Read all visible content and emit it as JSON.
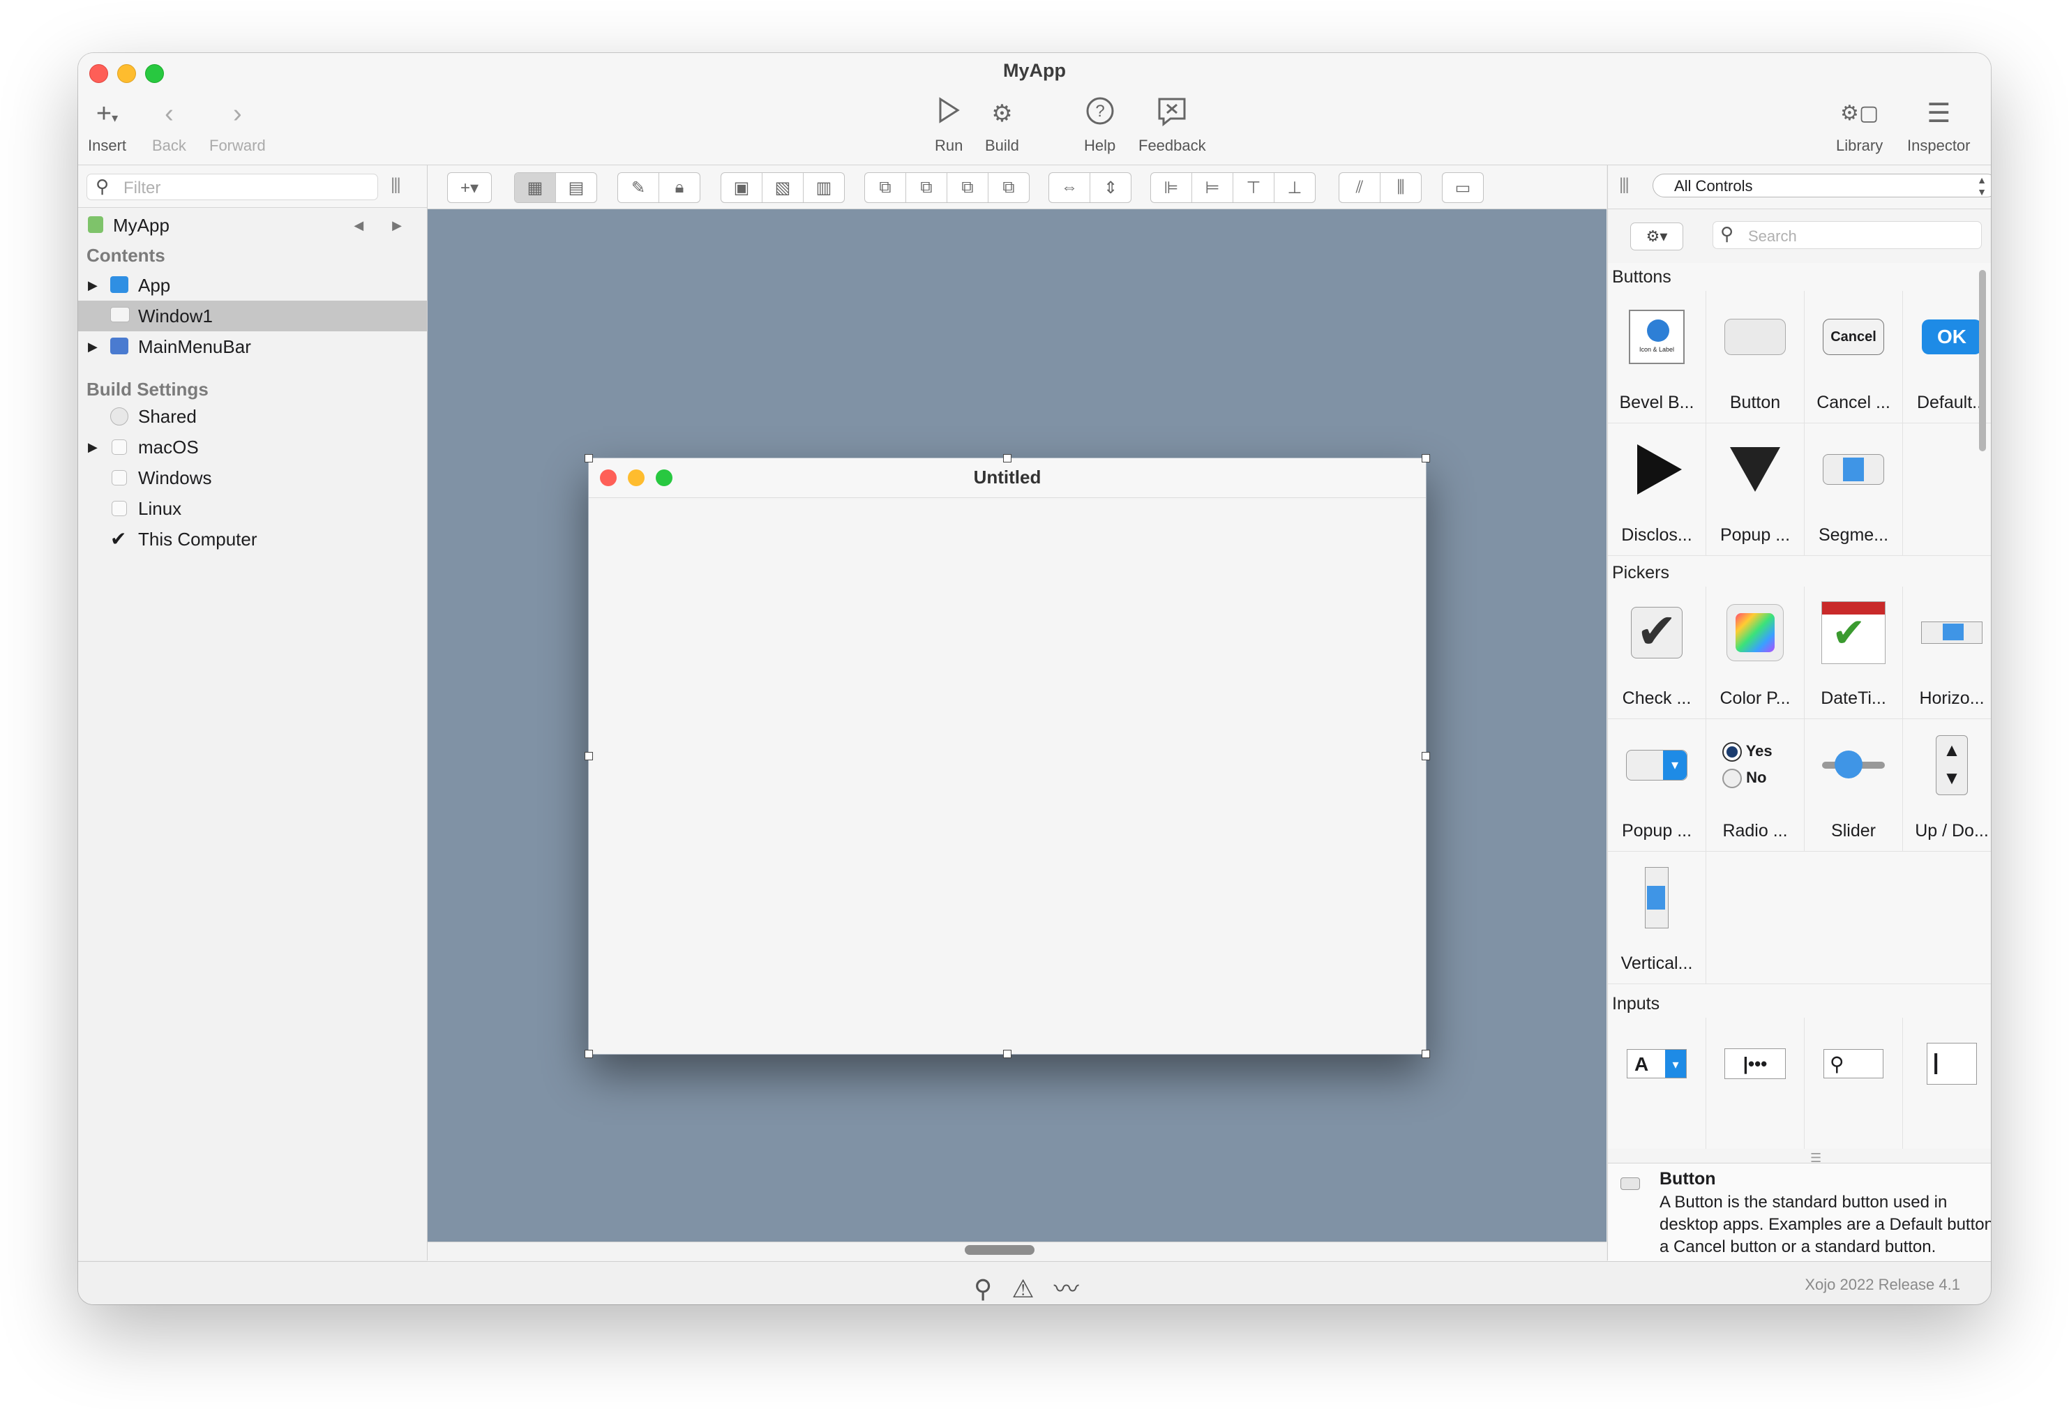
{
  "window": {
    "title": "MyApp"
  },
  "toolbar": {
    "insert": "Insert",
    "back": "Back",
    "forward": "Forward",
    "run": "Run",
    "build": "Build",
    "help": "Help",
    "feedback": "Feedback",
    "library": "Library",
    "inspector": "Inspector"
  },
  "navigator": {
    "filter_placeholder": "Filter",
    "project": "MyApp",
    "contents_header": "Contents",
    "items": [
      {
        "label": "App"
      },
      {
        "label": "Window1",
        "selected": true
      },
      {
        "label": "MainMenuBar"
      }
    ],
    "build_header": "Build Settings",
    "build_items": [
      {
        "label": "Shared"
      },
      {
        "label": "macOS",
        "checked": false
      },
      {
        "label": "Windows",
        "checked": false
      },
      {
        "label": "Linux",
        "checked": false
      },
      {
        "label": "This Computer",
        "checked": true
      }
    ]
  },
  "design_window": {
    "title": "Untitled"
  },
  "library": {
    "filter": "All Controls",
    "search_placeholder": "Search",
    "sections": {
      "buttons": "Buttons",
      "pickers": "Pickers",
      "inputs": "Inputs"
    },
    "buttons": [
      "Bevel B...",
      "Button",
      "Cancel ...",
      "Default...",
      "Disclos...",
      "Popup ...",
      "Segme..."
    ],
    "pickers": [
      "Check ...",
      "Color P...",
      "DateTi...",
      "Horizo...",
      "Popup ...",
      "Radio ...",
      "Slider",
      "Up / Do...",
      "Vertical..."
    ],
    "icon_text": {
      "bevel": "Icon & Label",
      "cancel": "Cancel",
      "ok": "OK",
      "radio_yes": "Yes",
      "radio_no": "No",
      "input_a": "A"
    },
    "description": {
      "title": "Button",
      "text": "A Button is the standard button used in desktop apps. Examples are a Default button, a Cancel button or a standard button."
    }
  },
  "status": {
    "version": "Xojo 2022 Release 4.1"
  },
  "colors": {
    "canvas": "#8092a5",
    "accent": "#1e8be6",
    "selection": "#c6c6c6"
  }
}
